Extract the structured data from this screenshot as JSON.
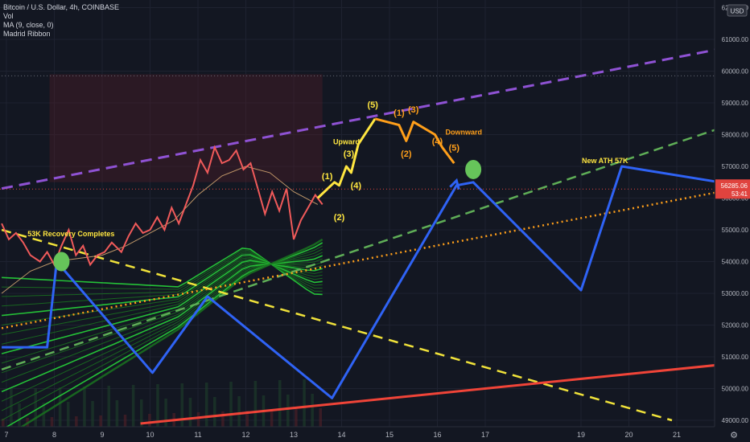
{
  "legend": {
    "symbol": "Bitcoin / U.S. Dollar, 4h, COINBASE",
    "vol": "Vol",
    "ma": "MA (9, close, 0)",
    "ribbon": "Madrid Ribbon"
  },
  "colors": {
    "background": "#131722",
    "grid": "#1e2230",
    "price": "#f05a5a",
    "ribbon_green": "#27d43a",
    "ribbon_dark": "#1a6e20",
    "blue_path": "#2f63f5",
    "yellow_wave": "#ffe640",
    "orange_wave": "#ff9f1a",
    "purple_dash": "#8f52d4",
    "green_dash": "#5fae57",
    "yellow_dash": "#f0e23a",
    "orange_dots": "#ff9f1a",
    "red_trend": "#f04438",
    "marker": "#66c45a",
    "price_tag": "#e0433e"
  },
  "chart_data": {
    "type": "line",
    "xlabel": "",
    "ylabel": "",
    "x_ticks": [
      "7",
      "8",
      "9",
      "10",
      "11",
      "12",
      "13",
      "14",
      "15",
      "16",
      "17",
      "19",
      "20",
      "21"
    ],
    "y_ticks": [
      "49000.00",
      "50000.00",
      "51000.00",
      "52000.00",
      "53000.00",
      "54000.00",
      "55000.00",
      "56000.00",
      "57000.00",
      "58000.00",
      "59000.00",
      "60000.00",
      "61000.00",
      "62000.00"
    ],
    "ylim": [
      48850,
      62200
    ],
    "currency": "USD",
    "last_price": "56285.06",
    "countdown": "53:41",
    "price_series": {
      "x": [
        6.9,
        7.05,
        7.2,
        7.35,
        7.5,
        7.7,
        7.85,
        8.0,
        8.15,
        8.3,
        8.45,
        8.6,
        8.75,
        8.9,
        9.05,
        9.2,
        9.4,
        9.55,
        9.7,
        9.85,
        10.0,
        10.15,
        10.3,
        10.45,
        10.6,
        10.75,
        10.9,
        11.05,
        11.2,
        11.35,
        11.5,
        11.65,
        11.8,
        11.95,
        12.1,
        12.25,
        12.4,
        12.55,
        12.7,
        12.85,
        13.0,
        13.15,
        13.3,
        13.45,
        13.6
      ],
      "y": [
        55200,
        54700,
        54900,
        54600,
        54200,
        54000,
        54300,
        53900,
        54500,
        55000,
        54200,
        54500,
        53900,
        54200,
        54300,
        54600,
        54300,
        54800,
        55200,
        54900,
        55000,
        55400,
        55000,
        55700,
        55200,
        55800,
        56400,
        57200,
        56800,
        57600,
        57100,
        57200,
        57500,
        56900,
        57100,
        56300,
        55500,
        56200,
        55600,
        56300,
        54700,
        55300,
        55700,
        56100,
        55800
      ]
    },
    "ma_series": {
      "x": [
        6.9,
        7.5,
        8.0,
        8.5,
        9.0,
        9.5,
        10.0,
        10.5,
        11.0,
        11.5,
        12.0,
        12.5,
        13.0,
        13.5
      ],
      "y": [
        53000,
        53700,
        54000,
        54100,
        54200,
        54500,
        54900,
        55300,
        56100,
        56700,
        57000,
        56800,
        56200,
        55800
      ]
    },
    "blue_path": {
      "x": [
        6.9,
        7.85,
        8.05,
        10.05,
        11.2,
        13.8,
        16.4,
        16.75,
        19.0,
        19.85,
        21.9
      ],
      "y": [
        51300,
        51300,
        54000,
        50500,
        52900,
        49700,
        56400,
        56500,
        53100,
        57000,
        56500
      ]
    },
    "yellow_wave": {
      "x": [
        13.5,
        13.85,
        13.95,
        14.1,
        14.2,
        14.35,
        14.7
      ],
      "y": [
        56000,
        56500,
        56400,
        57000,
        56800,
        57700,
        58500
      ]
    },
    "orange_wave": {
      "x": [
        14.7,
        15.2,
        15.35,
        15.5,
        15.95,
        16.1,
        16.35
      ],
      "y": [
        58500,
        58300,
        57800,
        58400,
        58000,
        57600,
        57100
      ]
    },
    "trendlines": [
      {
        "style": "purple-dashed",
        "x": [
          6.9,
          21.9
        ],
        "y": [
          56300,
          60700
        ]
      },
      {
        "style": "green-dashed",
        "x": [
          6.9,
          21.9
        ],
        "y": [
          50600,
          58200
        ]
      },
      {
        "style": "yellow-dashed",
        "x": [
          6.9,
          20.9
        ],
        "y": [
          55000,
          49000
        ]
      },
      {
        "style": "orange-dotted",
        "x": [
          6.9,
          21.9
        ],
        "y": [
          51900,
          56200
        ]
      },
      {
        "style": "red-solid",
        "x": [
          9.8,
          21.9
        ],
        "y": [
          48900,
          50750
        ]
      },
      {
        "style": "grey-dotted",
        "x": [
          6.9,
          21.9
        ],
        "y": [
          59850,
          59850
        ]
      }
    ],
    "markers": [
      {
        "x": 8.15,
        "y": 54000
      },
      {
        "x": 16.75,
        "y": 56900
      }
    ],
    "wave_labels": [
      {
        "text": "(1)",
        "x": 13.7,
        "y": 56600,
        "color": "yellow"
      },
      {
        "text": "(2)",
        "x": 13.95,
        "y": 55300,
        "color": "yellow"
      },
      {
        "text": "(3)",
        "x": 14.15,
        "y": 57300,
        "color": "yellow"
      },
      {
        "text": "(4)",
        "x": 14.3,
        "y": 56300,
        "color": "yellow"
      },
      {
        "text": "(5)",
        "x": 14.65,
        "y": 58850,
        "color": "yellow"
      },
      {
        "text": "(1)",
        "x": 15.2,
        "y": 58600,
        "color": "orange"
      },
      {
        "text": "(2)",
        "x": 15.35,
        "y": 57300,
        "color": "orange"
      },
      {
        "text": "(3)",
        "x": 15.5,
        "y": 58700,
        "color": "orange"
      },
      {
        "text": "(4)",
        "x": 16.0,
        "y": 57700,
        "color": "orange"
      },
      {
        "text": "(5)",
        "x": 16.35,
        "y": 57500,
        "color": "orange"
      }
    ],
    "annotations": [
      {
        "text": "53K Recovery Completes",
        "x": 8.35,
        "y": 54800,
        "color": "yellow"
      },
      {
        "text": "Upward",
        "x": 14.1,
        "y": 57700,
        "color": "yellow"
      },
      {
        "text": "Downward",
        "x": 16.55,
        "y": 58000,
        "color": "orange"
      },
      {
        "text": "New ATH 57K",
        "x": 19.5,
        "y": 57100,
        "color": "yellow"
      }
    ]
  }
}
